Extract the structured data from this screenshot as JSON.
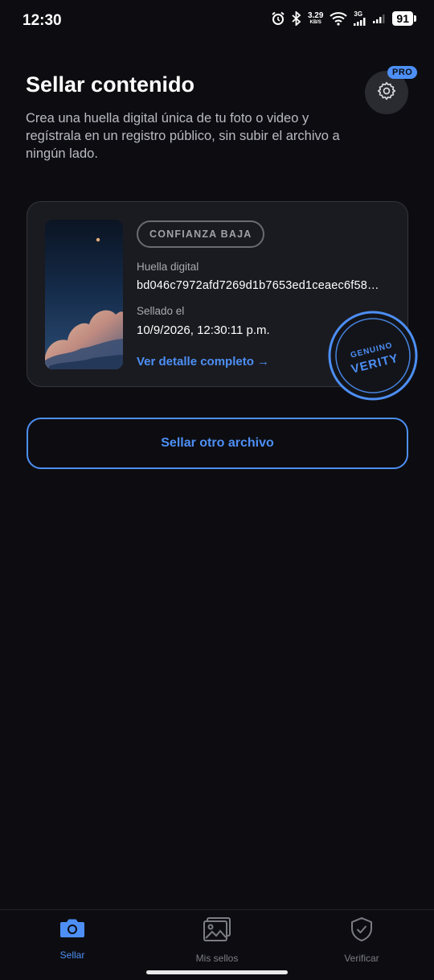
{
  "status_bar": {
    "time": "12:30",
    "net_speed_value": "3.29",
    "net_speed_unit": "KB/S",
    "network_type": "3G",
    "battery": "91"
  },
  "header": {
    "title": "Sellar contenido",
    "description": "Crea una huella digital única de tu foto o video y regístrala en un registro público, sin subir el archivo a ningún lado.",
    "pro_badge": "PRO",
    "settings_icon": "gear-icon"
  },
  "seal_card": {
    "confidence_chip": "CONFIANZA BAJA",
    "fingerprint_label": "Huella digital",
    "fingerprint_value": "bd046c7972afd7269d1b7653ed1ceaec6f58…",
    "sealed_label": "Sellado el",
    "sealed_value": "10/9/2026, 12:30:11 p.m.",
    "detail_link": "Ver detalle completo →",
    "stamp_top": "GENUINO",
    "stamp_main": "VERITY"
  },
  "actions": {
    "seal_other": "Sellar otro archivo"
  },
  "bottom_nav": [
    {
      "label": "Sellar",
      "icon": "camera-icon",
      "active": true
    },
    {
      "label": "Mis sellos",
      "icon": "gallery-icon",
      "active": false
    },
    {
      "label": "Verificar",
      "icon": "shield-check-icon",
      "active": false
    }
  ],
  "colors": {
    "background": "#0d0d11",
    "accent": "#4d8ff5",
    "card": "#1a1b20",
    "muted_text": "#a9aab2"
  }
}
